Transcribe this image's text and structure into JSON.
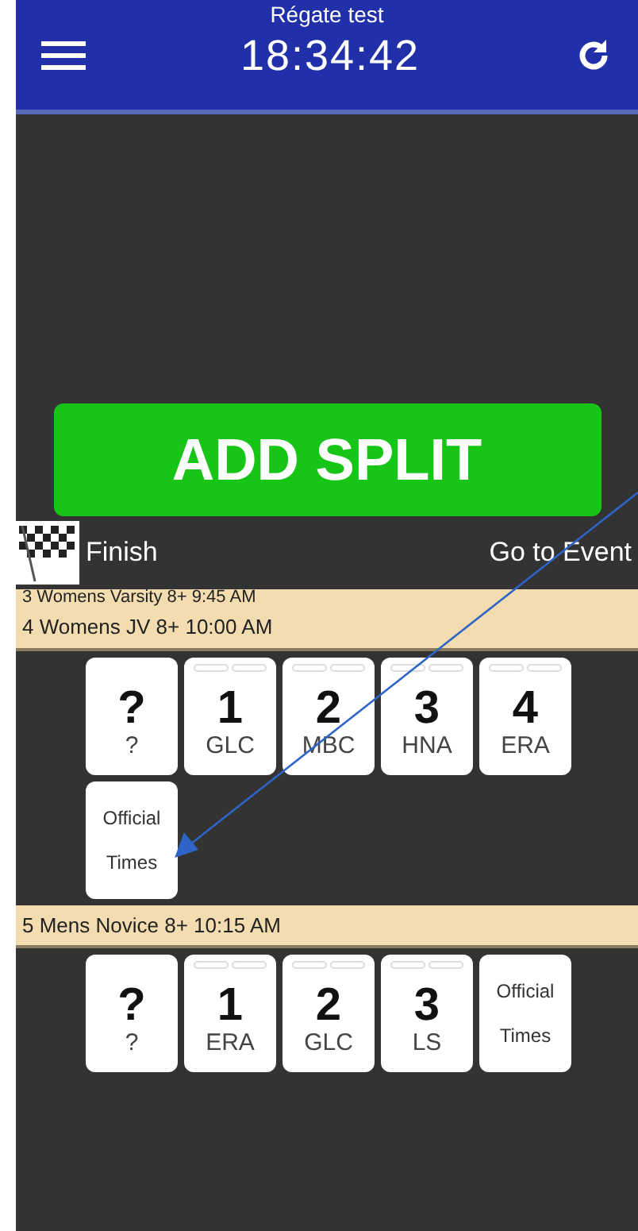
{
  "header": {
    "subtitle": "Régate test",
    "clock": "18:34:42"
  },
  "add_split": {
    "label": "ADD SPLIT"
  },
  "finish": {
    "label": "Finish"
  },
  "go_to_event": {
    "label": "Go to Event"
  },
  "races": [
    {
      "title": "3 Womens Varsity 8+ 9:45 AM"
    },
    {
      "title": "4 Womens JV 8+ 10:00 AM",
      "tiles": [
        {
          "kind": "unknown",
          "place": "?",
          "crew": "?"
        },
        {
          "kind": "boat",
          "place": "1",
          "crew": "GLC"
        },
        {
          "kind": "boat",
          "place": "2",
          "crew": "MBC"
        },
        {
          "kind": "boat",
          "place": "3",
          "crew": "HNA"
        },
        {
          "kind": "boat",
          "place": "4",
          "crew": "ERA"
        },
        {
          "kind": "official",
          "label": "Official Times"
        }
      ]
    },
    {
      "title": "5 Mens Novice 8+ 10:15 AM",
      "tiles": [
        {
          "kind": "unknown",
          "place": "?",
          "crew": "?"
        },
        {
          "kind": "boat",
          "place": "1",
          "crew": "ERA"
        },
        {
          "kind": "boat",
          "place": "2",
          "crew": "GLC"
        },
        {
          "kind": "boat",
          "place": "3",
          "crew": "LS"
        },
        {
          "kind": "official",
          "label": "Official Times"
        }
      ]
    }
  ]
}
